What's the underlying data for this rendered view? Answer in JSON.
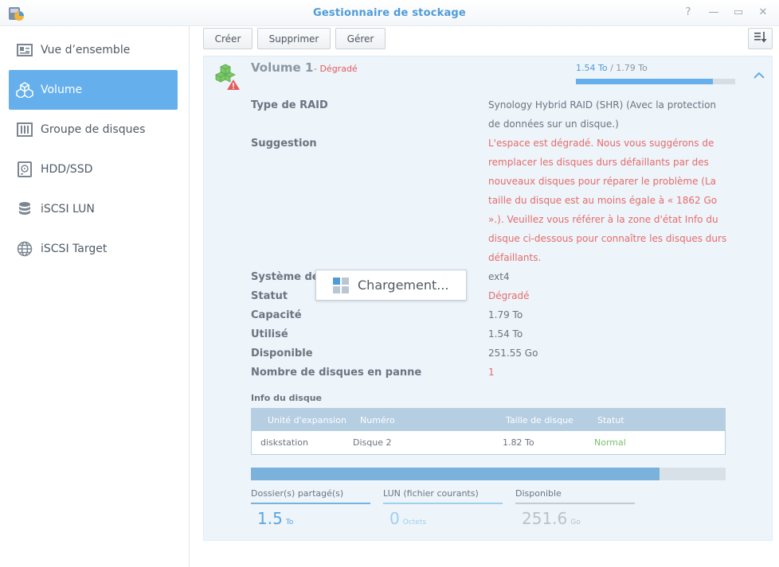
{
  "window": {
    "title": "Gestionnaire de stockage",
    "help_glyph": "?",
    "minimize_glyph": "—",
    "maximize_glyph": "▭",
    "close_glyph": "✕"
  },
  "sidebar": {
    "items": [
      {
        "label": "Vue d’ensemble",
        "icon": "overview-icon",
        "active": false
      },
      {
        "label": "Volume",
        "icon": "volume-icon",
        "active": true
      },
      {
        "label": "Groupe de disques",
        "icon": "disk-group-icon",
        "active": false
      },
      {
        "label": "HDD/SSD",
        "icon": "hdd-icon",
        "active": false
      },
      {
        "label": "iSCSI LUN",
        "icon": "database-icon",
        "active": false
      },
      {
        "label": "iSCSI Target",
        "icon": "globe-icon",
        "active": false
      }
    ]
  },
  "toolbar": {
    "create_label": "Créer",
    "delete_label": "Supprimer",
    "manage_label": "Gérer"
  },
  "volume": {
    "name": "Volume 1",
    "state": "- Dégradé",
    "used_text": "1.54 To",
    "total_text": "/ 1.79 To",
    "usage_fraction": 0.86,
    "details": {
      "raid_label": "Type de RAID",
      "raid_value": "Synology Hybrid RAID (SHR) (Avec la protection de données sur un disque.)",
      "suggestion_label": "Suggestion",
      "suggestion_value": "L'espace est dégradé. Nous vous suggérons de remplacer les disques durs défaillants par des nouveaux disques pour réparer le problème (La taille du disque est au moins égale à « 1862 Go ».). Veuillez vous référer à la zone d'état Info du disque ci-dessous pour connaître les disques durs défaillants.",
      "fs_label": "Système de",
      "fs_value": "ext4",
      "status_label": "Statut",
      "status_value": "Dégradé",
      "capacity_label": "Capacité",
      "capacity_value": "1.79 To",
      "used_label": "Utilisé",
      "used_value": "1.54 To",
      "available_label": "Disponible",
      "available_value": "251.55 Go",
      "failed_label": "Nombre de disques en panne",
      "failed_value": "1"
    },
    "disk_info": {
      "title": "Info du disque",
      "headers": [
        "Unité d'expansion",
        "Numéro",
        "Taille de disque",
        "Statut"
      ],
      "rows": [
        [
          "diskstation",
          "Disque 2",
          "1.82 To",
          "Normal"
        ]
      ]
    },
    "breakdown": {
      "fill_fraction": 0.86,
      "shared": {
        "label": "Dossier(s) partagé(s)",
        "value": "1.5",
        "unit": "To"
      },
      "lun": {
        "label": "LUN (fichier courants)",
        "value": "0",
        "unit": "Octets"
      },
      "available": {
        "label": "Disponible",
        "value": "251.6",
        "unit": "Go"
      }
    }
  },
  "loading": {
    "text": "Chargement..."
  },
  "colors": {
    "accent": "#65b0ec",
    "title": "#4f9bd9",
    "error": "#e35b5b",
    "normal": "#7cbf6e",
    "panel": "#edf4fa"
  }
}
